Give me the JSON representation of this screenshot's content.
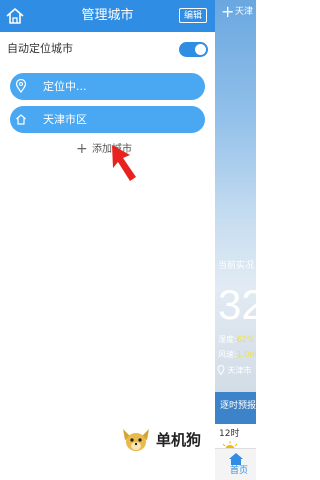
{
  "header": {
    "title": "管理城市",
    "edit_label": "编辑"
  },
  "auto_locate": {
    "label": "自动定位城市",
    "enabled": true
  },
  "cities": [
    {
      "label": "定位中...",
      "icon": "location-pin-icon"
    },
    {
      "label": "天津市区",
      "icon": "home-icon"
    }
  ],
  "add_city": {
    "label": "添加城市",
    "icon": "plus-icon"
  },
  "weather": {
    "city_partial": "天津",
    "observed_partial": "当前实况",
    "temp_partial": "32",
    "humidity_label": "湿度:",
    "humidity_value": "62%",
    "wind_label": "风速:",
    "wind_value": "1.0m",
    "location_partial": "天津市",
    "forecast_partial": "逐时预报",
    "hour_partial": "12时",
    "nav_home": "首页"
  },
  "watermark": {
    "text": "单机狗"
  },
  "colors": {
    "accent": "#2f8de4",
    "city_pill": "#4aa8f2",
    "pointer_arrow": "#e8231f"
  }
}
